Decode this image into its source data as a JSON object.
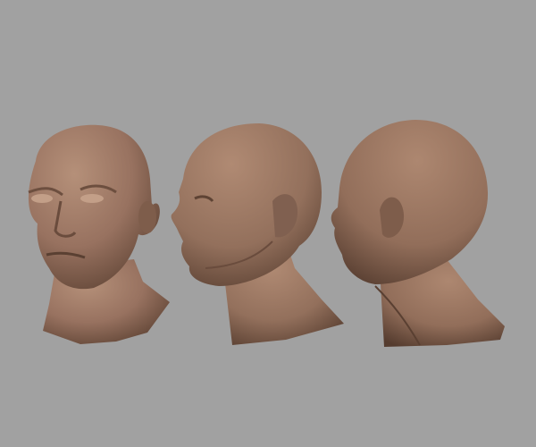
{
  "colors": {
    "background": "#a1a1a1",
    "skin_light": "#b08a73",
    "skin_mid": "#96705b",
    "skin_dark": "#5e4334"
  }
}
